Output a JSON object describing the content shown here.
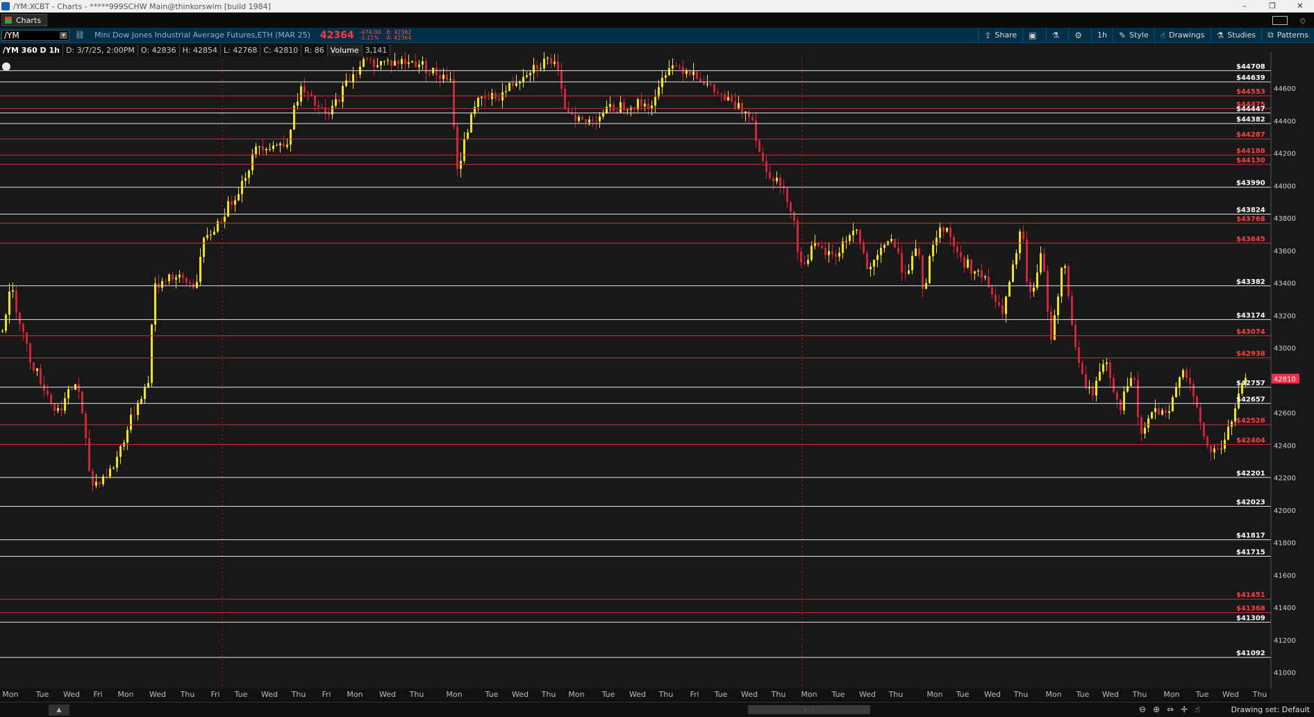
{
  "window": {
    "title": "/YM:XCBT - Charts - *****999SCHW Main@thinkorswim [build 1984]",
    "controls": [
      "–",
      "❐",
      "✕"
    ]
  },
  "tabbar": {
    "tab_label": "Charts"
  },
  "toolbar": {
    "symbol": "/YM",
    "instrument": "Mini Dow Jones Industrial Average Futures,ETH (MAR 25)",
    "last_price": "42364",
    "net_change": "-474.00",
    "pct_change": "-1.11%",
    "bid": "B: 42362",
    "ask": "A: 42364",
    "buttons": {
      "share": "Share",
      "timeframe": "1h",
      "style": "Style",
      "drawings": "Drawings",
      "studies": "Studies",
      "patterns": "Patterns"
    }
  },
  "infobar": {
    "chart_label": "/YM 360 D 1h",
    "date": "D: 3/7/25, 2:00PM",
    "open": "O: 42836",
    "high": "H: 42854",
    "low": "L: 42768",
    "close": "C: 42810",
    "range": "R: 86",
    "volume_label": "Volume",
    "volume_value": "3,141"
  },
  "chart_data": {
    "type": "candlestick",
    "ylim": [
      40900,
      44780
    ],
    "y_ticks": [
      41000,
      41200,
      41400,
      41600,
      41800,
      42000,
      42200,
      42400,
      42600,
      42800,
      43000,
      43200,
      43400,
      43600,
      43800,
      44000,
      44200,
      44400,
      44600
    ],
    "current_price": 42810,
    "x_day_labels": [
      "Mon",
      "Tue",
      "Wed",
      "Fri",
      "Mon",
      "Wed",
      "Thu",
      "Fri",
      "Tue",
      "Wed",
      "Thu",
      "Fri",
      "Mon",
      "Wed",
      "Thu",
      "Mon",
      "Tue",
      "Wed",
      "Thu",
      "Mon",
      "Tue",
      "Wed",
      "Thu",
      "Fri",
      "Tue",
      "Wed",
      "Thu",
      "Mon",
      "Tue",
      "Wed",
      "Thu",
      "Mon",
      "Tue",
      "Wed",
      "Thu",
      "Mon",
      "Tue",
      "Wed",
      "Thu",
      "Mon",
      "Tue",
      "Wed",
      "Thu"
    ],
    "x_day_positions": [
      15,
      61,
      103,
      141,
      181,
      227,
      270,
      310,
      347,
      388,
      430,
      470,
      511,
      558,
      600,
      654,
      708,
      749,
      790,
      830,
      876,
      918,
      959,
      1000,
      1038,
      1079,
      1121,
      1165,
      1207,
      1249,
      1290,
      1346,
      1386,
      1429,
      1470,
      1517,
      1559,
      1599,
      1641,
      1687,
      1731,
      1772,
      1814
    ],
    "levels": [
      {
        "price": 44708,
        "color": "white"
      },
      {
        "price": 44639,
        "color": "white"
      },
      {
        "price": 44553,
        "color": "red"
      },
      {
        "price": 44475,
        "color": "red"
      },
      {
        "price": 44447,
        "color": "white"
      },
      {
        "price": 44382,
        "color": "white"
      },
      {
        "price": 44287,
        "color": "red"
      },
      {
        "price": 44188,
        "color": "red"
      },
      {
        "price": 44130,
        "color": "red"
      },
      {
        "price": 43990,
        "color": "white"
      },
      {
        "price": 43824,
        "color": "white"
      },
      {
        "price": 43768,
        "color": "red"
      },
      {
        "price": 43645,
        "color": "red"
      },
      {
        "price": 43382,
        "color": "white"
      },
      {
        "price": 43174,
        "color": "white"
      },
      {
        "price": 43074,
        "color": "red"
      },
      {
        "price": 42938,
        "color": "red"
      },
      {
        "price": 42757,
        "color": "white"
      },
      {
        "price": 42657,
        "color": "white"
      },
      {
        "price": 42526,
        "color": "red"
      },
      {
        "price": 42404,
        "color": "red"
      },
      {
        "price": 42201,
        "color": "white"
      },
      {
        "price": 42023,
        "color": "white"
      },
      {
        "price": 41817,
        "color": "white"
      },
      {
        "price": 41715,
        "color": "white"
      },
      {
        "price": 41451,
        "color": "red"
      },
      {
        "price": 41368,
        "color": "red"
      },
      {
        "price": 41309,
        "color": "white"
      },
      {
        "price": 41092,
        "color": "white"
      }
    ],
    "colors": {
      "up": "#f2e600",
      "down": "#d0243c",
      "volume": "#0f4a6e",
      "white_level": "#e8e8e8",
      "red_level": "#d03030",
      "red_label": "#ff4040",
      "price_tag": "#ff2d4a"
    }
  },
  "bottombar": {
    "up_arrow": "▲",
    "drawing_set": "Drawing set: Default"
  }
}
